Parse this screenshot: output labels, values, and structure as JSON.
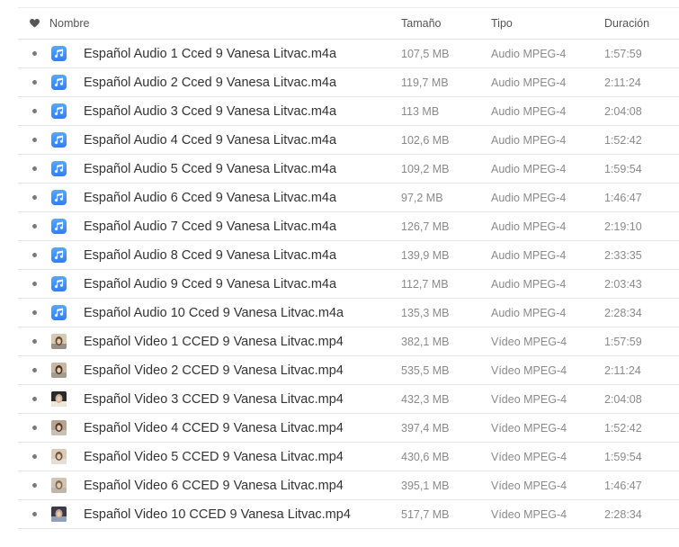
{
  "header": {
    "name": "Nombre",
    "size": "Tamaño",
    "type": "Tipo",
    "duration": "Duración",
    "heart_icon": "heart-icon"
  },
  "colors": {
    "audio_icon": "#3b8cf5",
    "text": "#333333",
    "muted": "#8a8a8a"
  },
  "rows": [
    {
      "kind": "audio",
      "icon": "music-note-icon",
      "name": "Español Audio 1 Cced 9 Vanesa Litvac.m4a",
      "size": "107,5 MB",
      "type": "Audio MPEG-4",
      "duration": "1:57:59"
    },
    {
      "kind": "audio",
      "icon": "music-note-icon",
      "name": "Español Audio 2 Cced 9 Vanesa Litvac.m4a",
      "size": "119,7 MB",
      "type": "Audio MPEG-4",
      "duration": "2:11:24"
    },
    {
      "kind": "audio",
      "icon": "music-note-icon",
      "name": "Español Audio 3 Cced 9 Vanesa Litvac.m4a",
      "size": "113 MB",
      "type": "Audio MPEG-4",
      "duration": "2:04:08"
    },
    {
      "kind": "audio",
      "icon": "music-note-icon",
      "name": "Español Audio 4 Cced 9 Vanesa Litvac.m4a",
      "size": "102,6 MB",
      "type": "Audio MPEG-4",
      "duration": "1:52:42"
    },
    {
      "kind": "audio",
      "icon": "music-note-icon",
      "name": "Español Audio 5 Cced 9 Vanesa Litvac.m4a",
      "size": "109,2 MB",
      "type": "Audio MPEG-4",
      "duration": "1:59:54"
    },
    {
      "kind": "audio",
      "icon": "music-note-icon",
      "name": "Español Audio 6 Cced 9 Vanesa Litvac.m4a",
      "size": "97,2 MB",
      "type": "Audio MPEG-4",
      "duration": "1:46:47"
    },
    {
      "kind": "audio",
      "icon": "music-note-icon",
      "name": "Español Audio 7 Cced 9 Vanesa Litvac.m4a",
      "size": "126,7 MB",
      "type": "Audio MPEG-4",
      "duration": "2:19:10"
    },
    {
      "kind": "audio",
      "icon": "music-note-icon",
      "name": "Español Audio 8 Cced 9 Vanesa Litvac.m4a",
      "size": "139,9 MB",
      "type": "Audio MPEG-4",
      "duration": "2:33:35"
    },
    {
      "kind": "audio",
      "icon": "music-note-icon",
      "name": "Español Audio 9 Cced 9 Vanesa Litvac.m4a",
      "size": "112,7 MB",
      "type": "Audio MPEG-4",
      "duration": "2:03:43"
    },
    {
      "kind": "audio",
      "icon": "music-note-icon",
      "name": "Español Audio 10 Cced 9 Vanesa Litvac.m4a",
      "size": "135,3 MB",
      "type": "Audio MPEG-4",
      "duration": "2:28:34"
    },
    {
      "kind": "video",
      "icon": "video-thumbnail-icon",
      "name": "Español Video 1 CCED 9 Vanesa Litvac.mp4",
      "size": "382,1 MB",
      "type": "Vídeo MPEG-4",
      "duration": "1:57:59"
    },
    {
      "kind": "video",
      "icon": "video-thumbnail-icon",
      "name": "Español Video 2 CCED 9 Vanesa Litvac.mp4",
      "size": "535,5 MB",
      "type": "Vídeo MPEG-4",
      "duration": "2:11:24"
    },
    {
      "kind": "video",
      "icon": "video-thumbnail-icon",
      "name": "Español Video 3 CCED 9 Vanesa Litvac.mp4",
      "size": "432,3 MB",
      "type": "Vídeo MPEG-4",
      "duration": "2:04:08"
    },
    {
      "kind": "video",
      "icon": "video-thumbnail-icon",
      "name": "Español Video 4 CCED 9 Vanesa Litvac.mp4",
      "size": "397,4 MB",
      "type": "Vídeo MPEG-4",
      "duration": "1:52:42"
    },
    {
      "kind": "video",
      "icon": "video-thumbnail-icon",
      "name": "Español Video 5 CCED 9 Vanesa Litvac.mp4",
      "size": "430,6 MB",
      "type": "Vídeo MPEG-4",
      "duration": "1:59:54"
    },
    {
      "kind": "video",
      "icon": "video-thumbnail-icon",
      "name": "Español Video 6 CCED 9 Vanesa Litvac.mp4",
      "size": "395,1 MB",
      "type": "Vídeo MPEG-4",
      "duration": "1:46:47"
    },
    {
      "kind": "video",
      "icon": "video-thumbnail-icon",
      "name": "Español Video 10 CCED 9 Vanesa Litvac.mp4",
      "size": "517,7 MB",
      "type": "Vídeo MPEG-4",
      "duration": "2:28:34"
    }
  ]
}
